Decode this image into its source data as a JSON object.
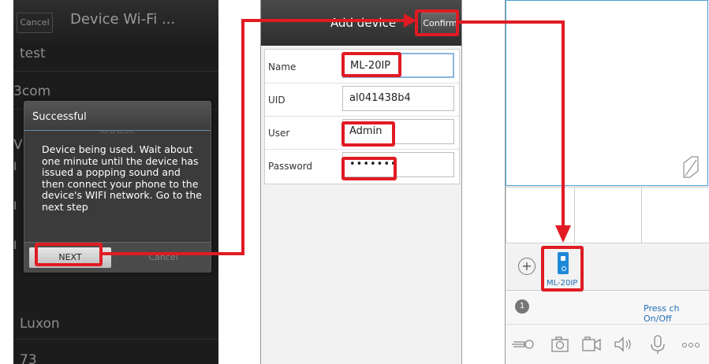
{
  "panel_wifi": {
    "cancel_label": "Cancel",
    "title": "Device Wi-Fi ...",
    "networks": [
      "test",
      "3com",
      "V",
      "I",
      "I",
      "I",
      "Luxon",
      "73"
    ],
    "dialog": {
      "title": "Successful",
      "ghost_text": "Guest",
      "message": "Device being used. Wait about one minute until the device has issued a popping sound and then connect your phone to the device's WIFI network. Go to the next step",
      "next_label": "NEXT",
      "cancel_label": "Cancel"
    }
  },
  "panel_add": {
    "title": "Add device",
    "confirm_label": "Confirm",
    "fields": [
      {
        "label": "Name",
        "value": "ML-20IP"
      },
      {
        "label": "UID",
        "value": "al041438b4"
      },
      {
        "label": "User",
        "value": "Admin"
      },
      {
        "label": "Password",
        "value": "•••••••"
      }
    ]
  },
  "panel_view": {
    "add_icon": "plus-circle-icon",
    "device_name": "ML-20IP",
    "channel_number": "1",
    "press_label": "Press ch On/Off",
    "tools": [
      "key-icon",
      "camera-icon",
      "video-icon",
      "speaker-icon",
      "microphone-icon",
      "more-icon"
    ]
  },
  "colors": {
    "highlight": "#e01b24",
    "accent_blue": "#1e88d8"
  }
}
